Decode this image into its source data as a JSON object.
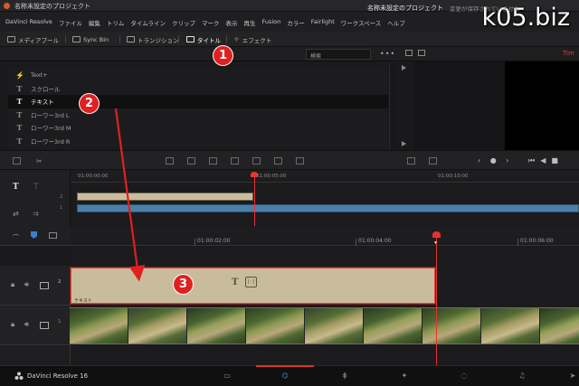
{
  "window": {
    "title": "名称未設定のプロジェクト"
  },
  "watermark": "k05.biz",
  "menu": [
    "DaVinci Resolve",
    "ファイル",
    "編集",
    "トリム",
    "タイムライン",
    "クリップ",
    "マーク",
    "表示",
    "再生",
    "Fusion",
    "カラー",
    "Fairlight",
    "ワークスペース",
    "ヘルプ"
  ],
  "toolbar": {
    "media_pool": "メディアプール",
    "sync_bin": "Sync Bin",
    "transitions": "トランジション",
    "titles": "タイトル",
    "effects": "エフェクト",
    "project_name": "名称未設定のプロジェクト",
    "status": "変更が保存されていません"
  },
  "search": {
    "placeholder": "検索"
  },
  "titles_list": [
    {
      "icon": "⚡",
      "label": "Text+"
    },
    {
      "icon": "T",
      "label": "スクロール"
    },
    {
      "icon": "T",
      "label": "テキスト",
      "selected": true
    },
    {
      "icon": "T",
      "label": "ローワー3rd L"
    },
    {
      "icon": "T",
      "label": "ローワー3rd M"
    },
    {
      "icon": "T",
      "label": "ローワー3rd R"
    }
  ],
  "mini_ruler": [
    "01:00:00:00",
    "01:00:05:00",
    "01:00:10:00"
  ],
  "main_ruler": [
    "01:00:02:00",
    "01:00:04:00",
    "01:00:06:00"
  ],
  "tracks": {
    "v2": "2",
    "v1": "1"
  },
  "text_clip_label": "テキスト",
  "viewer_timecode": "Tim",
  "pages": [
    "media",
    "cut",
    "edit",
    "fusion",
    "color",
    "fairlight",
    "deliver"
  ],
  "active_page": "edit",
  "brand": "DaVinci Resolve 16",
  "annotations": [
    "1",
    "2",
    "3"
  ],
  "colors": {
    "playhead": "#e83030",
    "text_clip": "#c9bc9c",
    "audio_blue": "#4a7fa8",
    "badge": "#e02020"
  }
}
